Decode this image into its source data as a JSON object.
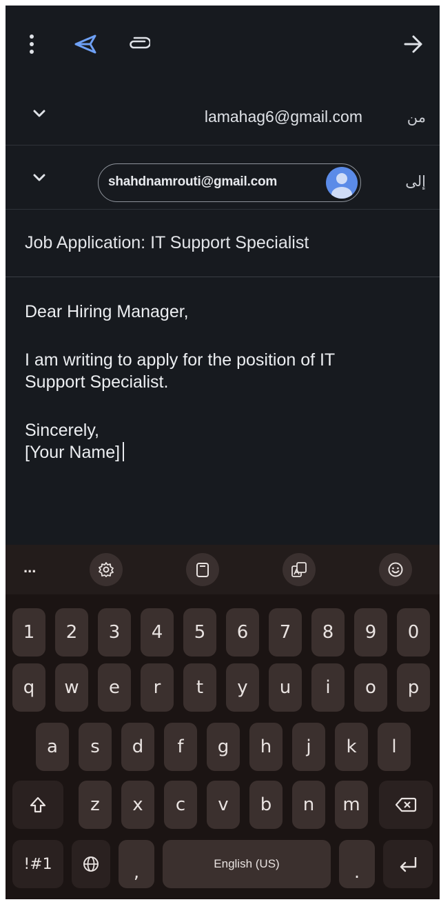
{
  "header": {
    "actions": [
      "more-options",
      "send",
      "attach",
      "forward"
    ]
  },
  "from": {
    "label": "من",
    "value": "lamahag6@gmail.com"
  },
  "to": {
    "label": "إلى",
    "recipient": "shahdnamrouti@gmail.com"
  },
  "subject": "Job Application: IT Support Specialist",
  "body": {
    "greeting": "Dear Hiring Manager,",
    "line1": "I am writing to apply for the position of IT",
    "line2": "Support Specialist.",
    "closing": "Sincerely,",
    "signature": "[Your Name]"
  },
  "keyboard": {
    "toolbar": {
      "more_label": "...",
      "icons": [
        "settings-icon",
        "clipboard-icon",
        "translate-icon",
        "emoji-icon"
      ]
    },
    "row_numbers": [
      "1",
      "2",
      "3",
      "4",
      "5",
      "6",
      "7",
      "8",
      "9",
      "0"
    ],
    "row1": [
      "q",
      "w",
      "e",
      "r",
      "t",
      "y",
      "u",
      "i",
      "o",
      "p"
    ],
    "row2": [
      "a",
      "s",
      "d",
      "f",
      "g",
      "h",
      "j",
      "k",
      "l"
    ],
    "row3": [
      "z",
      "x",
      "c",
      "v",
      "b",
      "n",
      "m"
    ],
    "symbols_label": "!#1",
    "comma_label": ",",
    "space_label": "English (US)",
    "period_label": "."
  },
  "colors": {
    "background": "#171a1f",
    "accent": "#5b8be8",
    "keyboard_bg": "#1b1413",
    "key_bg": "#3b302e"
  }
}
